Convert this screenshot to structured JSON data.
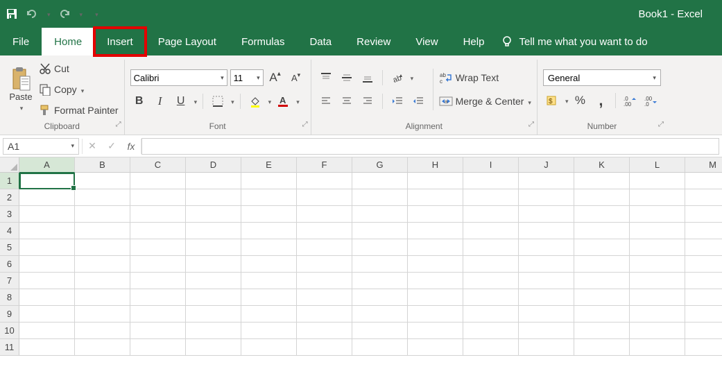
{
  "title": "Book1  -  Excel",
  "tabs": [
    "File",
    "Home",
    "Insert",
    "Page Layout",
    "Formulas",
    "Data",
    "Review",
    "View",
    "Help"
  ],
  "activeTab": "Home",
  "highlightedTab": "Insert",
  "tellMe": "Tell me what you want to do",
  "clipboard": {
    "label": "Clipboard",
    "paste": "Paste",
    "cut": "Cut",
    "copy": "Copy",
    "formatPainter": "Format Painter"
  },
  "font": {
    "label": "Font",
    "name": "Calibri",
    "size": "11",
    "bold": "B",
    "italic": "I",
    "underline": "U"
  },
  "alignment": {
    "label": "Alignment",
    "wrap": "Wrap Text",
    "merge": "Merge & Center"
  },
  "number": {
    "label": "Number",
    "format": "General",
    "percent": "%",
    "comma": ","
  },
  "nameBox": "A1",
  "columns": [
    "A",
    "B",
    "C",
    "D",
    "E",
    "F",
    "G",
    "H",
    "I",
    "J",
    "K",
    "L",
    "M"
  ],
  "rows": [
    "1",
    "2",
    "3",
    "4",
    "5",
    "6",
    "7",
    "8",
    "9",
    "10",
    "11"
  ],
  "fx": "fx"
}
